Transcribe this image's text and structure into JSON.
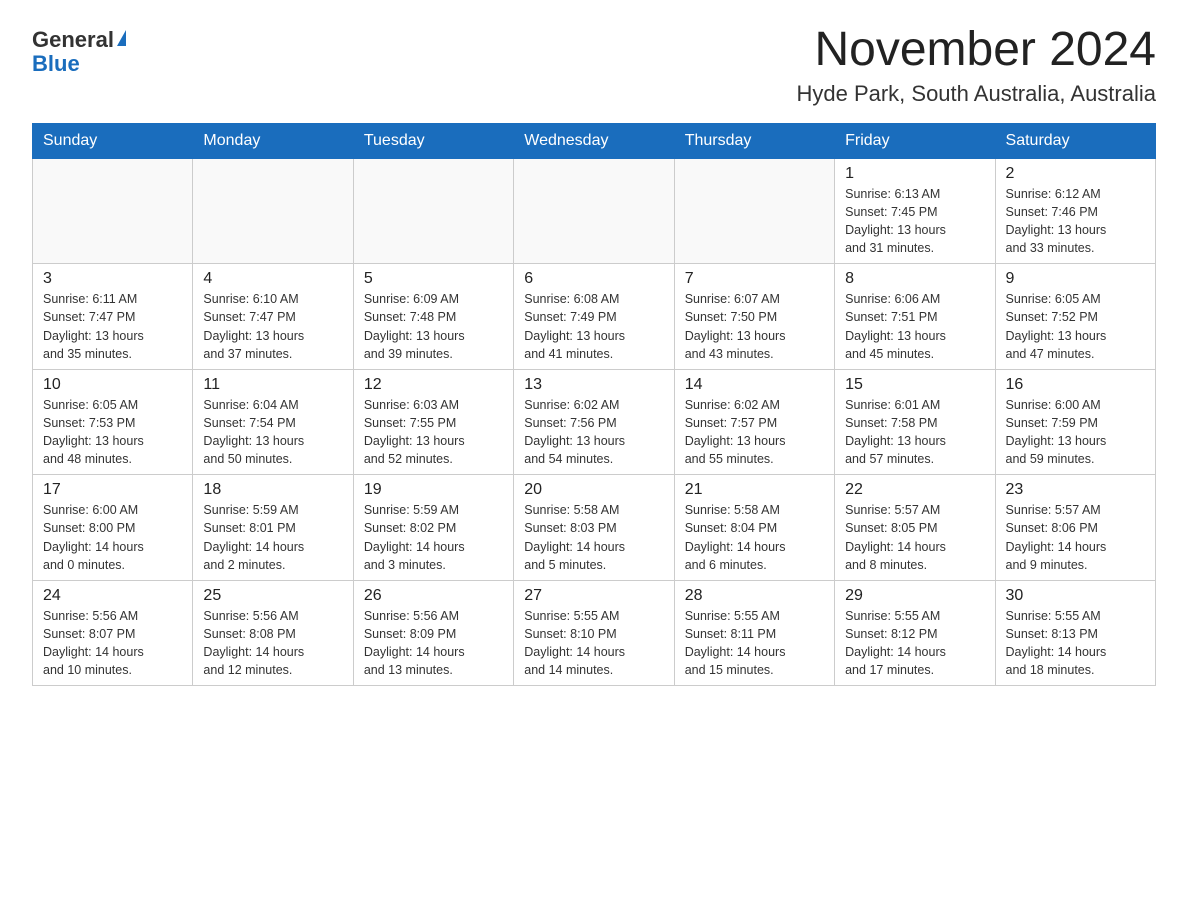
{
  "header": {
    "logo_general": "General",
    "logo_blue": "Blue",
    "month_title": "November 2024",
    "location": "Hyde Park, South Australia, Australia"
  },
  "days_of_week": [
    "Sunday",
    "Monday",
    "Tuesday",
    "Wednesday",
    "Thursday",
    "Friday",
    "Saturday"
  ],
  "weeks": [
    [
      {
        "day": "",
        "info": ""
      },
      {
        "day": "",
        "info": ""
      },
      {
        "day": "",
        "info": ""
      },
      {
        "day": "",
        "info": ""
      },
      {
        "day": "",
        "info": ""
      },
      {
        "day": "1",
        "info": "Sunrise: 6:13 AM\nSunset: 7:45 PM\nDaylight: 13 hours\nand 31 minutes."
      },
      {
        "day": "2",
        "info": "Sunrise: 6:12 AM\nSunset: 7:46 PM\nDaylight: 13 hours\nand 33 minutes."
      }
    ],
    [
      {
        "day": "3",
        "info": "Sunrise: 6:11 AM\nSunset: 7:47 PM\nDaylight: 13 hours\nand 35 minutes."
      },
      {
        "day": "4",
        "info": "Sunrise: 6:10 AM\nSunset: 7:47 PM\nDaylight: 13 hours\nand 37 minutes."
      },
      {
        "day": "5",
        "info": "Sunrise: 6:09 AM\nSunset: 7:48 PM\nDaylight: 13 hours\nand 39 minutes."
      },
      {
        "day": "6",
        "info": "Sunrise: 6:08 AM\nSunset: 7:49 PM\nDaylight: 13 hours\nand 41 minutes."
      },
      {
        "day": "7",
        "info": "Sunrise: 6:07 AM\nSunset: 7:50 PM\nDaylight: 13 hours\nand 43 minutes."
      },
      {
        "day": "8",
        "info": "Sunrise: 6:06 AM\nSunset: 7:51 PM\nDaylight: 13 hours\nand 45 minutes."
      },
      {
        "day": "9",
        "info": "Sunrise: 6:05 AM\nSunset: 7:52 PM\nDaylight: 13 hours\nand 47 minutes."
      }
    ],
    [
      {
        "day": "10",
        "info": "Sunrise: 6:05 AM\nSunset: 7:53 PM\nDaylight: 13 hours\nand 48 minutes."
      },
      {
        "day": "11",
        "info": "Sunrise: 6:04 AM\nSunset: 7:54 PM\nDaylight: 13 hours\nand 50 minutes."
      },
      {
        "day": "12",
        "info": "Sunrise: 6:03 AM\nSunset: 7:55 PM\nDaylight: 13 hours\nand 52 minutes."
      },
      {
        "day": "13",
        "info": "Sunrise: 6:02 AM\nSunset: 7:56 PM\nDaylight: 13 hours\nand 54 minutes."
      },
      {
        "day": "14",
        "info": "Sunrise: 6:02 AM\nSunset: 7:57 PM\nDaylight: 13 hours\nand 55 minutes."
      },
      {
        "day": "15",
        "info": "Sunrise: 6:01 AM\nSunset: 7:58 PM\nDaylight: 13 hours\nand 57 minutes."
      },
      {
        "day": "16",
        "info": "Sunrise: 6:00 AM\nSunset: 7:59 PM\nDaylight: 13 hours\nand 59 minutes."
      }
    ],
    [
      {
        "day": "17",
        "info": "Sunrise: 6:00 AM\nSunset: 8:00 PM\nDaylight: 14 hours\nand 0 minutes."
      },
      {
        "day": "18",
        "info": "Sunrise: 5:59 AM\nSunset: 8:01 PM\nDaylight: 14 hours\nand 2 minutes."
      },
      {
        "day": "19",
        "info": "Sunrise: 5:59 AM\nSunset: 8:02 PM\nDaylight: 14 hours\nand 3 minutes."
      },
      {
        "day": "20",
        "info": "Sunrise: 5:58 AM\nSunset: 8:03 PM\nDaylight: 14 hours\nand 5 minutes."
      },
      {
        "day": "21",
        "info": "Sunrise: 5:58 AM\nSunset: 8:04 PM\nDaylight: 14 hours\nand 6 minutes."
      },
      {
        "day": "22",
        "info": "Sunrise: 5:57 AM\nSunset: 8:05 PM\nDaylight: 14 hours\nand 8 minutes."
      },
      {
        "day": "23",
        "info": "Sunrise: 5:57 AM\nSunset: 8:06 PM\nDaylight: 14 hours\nand 9 minutes."
      }
    ],
    [
      {
        "day": "24",
        "info": "Sunrise: 5:56 AM\nSunset: 8:07 PM\nDaylight: 14 hours\nand 10 minutes."
      },
      {
        "day": "25",
        "info": "Sunrise: 5:56 AM\nSunset: 8:08 PM\nDaylight: 14 hours\nand 12 minutes."
      },
      {
        "day": "26",
        "info": "Sunrise: 5:56 AM\nSunset: 8:09 PM\nDaylight: 14 hours\nand 13 minutes."
      },
      {
        "day": "27",
        "info": "Sunrise: 5:55 AM\nSunset: 8:10 PM\nDaylight: 14 hours\nand 14 minutes."
      },
      {
        "day": "28",
        "info": "Sunrise: 5:55 AM\nSunset: 8:11 PM\nDaylight: 14 hours\nand 15 minutes."
      },
      {
        "day": "29",
        "info": "Sunrise: 5:55 AM\nSunset: 8:12 PM\nDaylight: 14 hours\nand 17 minutes."
      },
      {
        "day": "30",
        "info": "Sunrise: 5:55 AM\nSunset: 8:13 PM\nDaylight: 14 hours\nand 18 minutes."
      }
    ]
  ]
}
